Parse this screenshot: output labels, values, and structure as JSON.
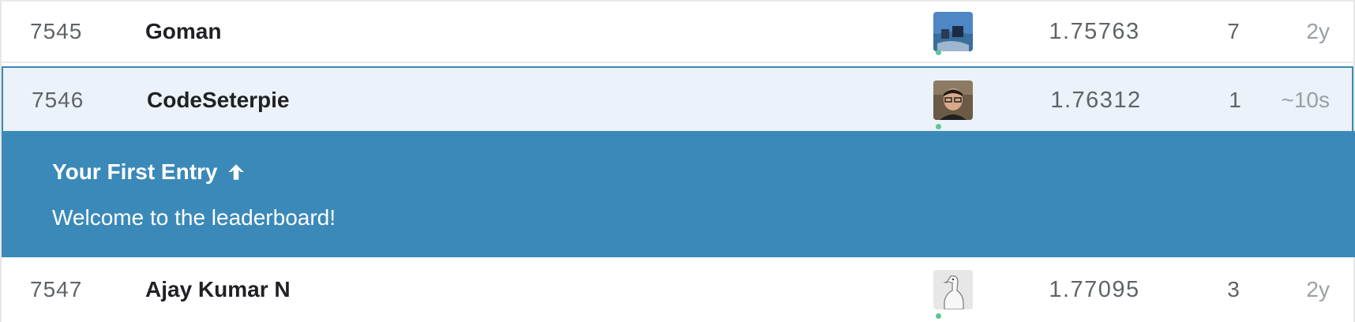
{
  "leaderboard": {
    "rows": [
      {
        "rank": "7545",
        "name": "Goman",
        "score": "1.75763",
        "entries": "7",
        "last": "2y",
        "avatar": "team-photo-lake"
      },
      {
        "rank": "7546",
        "name": "CodeSeterpie",
        "score": "1.76312",
        "entries": "1",
        "last": "~10s",
        "avatar": "user-photo-glasses"
      },
      {
        "rank": "7547",
        "name": "Ajay Kumar N",
        "score": "1.77095",
        "entries": "3",
        "last": "2y",
        "avatar": "goose-sketch"
      }
    ]
  },
  "banner": {
    "title": "Your First Entry",
    "icon": "arrow-up-icon",
    "message": "Welcome to the leaderboard!"
  },
  "colors": {
    "banner": "#3b89b8",
    "highlight_bg": "#ebf2f9",
    "highlight_border": "#3b88b8",
    "online_dot": "#5cc695"
  }
}
